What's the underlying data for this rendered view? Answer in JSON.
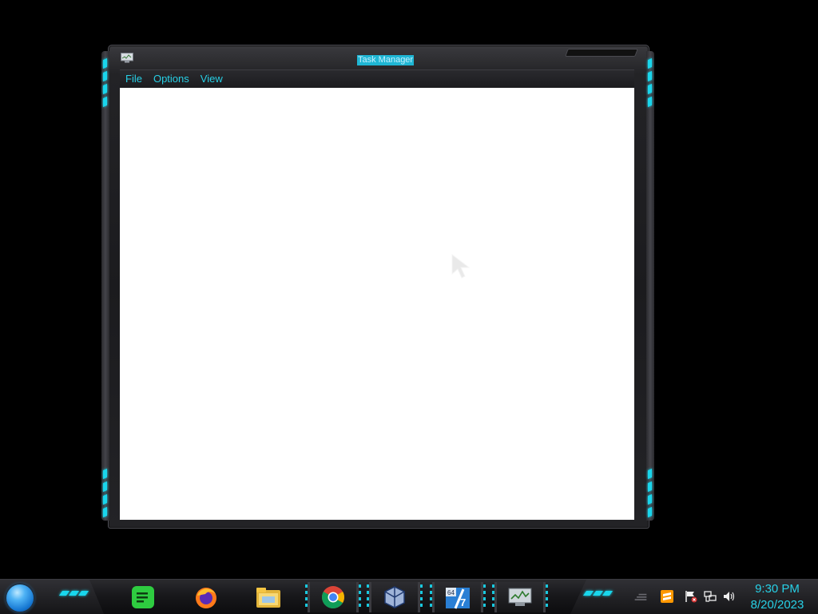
{
  "window": {
    "title": "Task Manager",
    "menu": [
      "File",
      "Options",
      "View"
    ]
  },
  "taskbar": {
    "start_button": "start-orb",
    "pinned": [
      {
        "name": "notes-app-icon",
        "color": "#2ecc40"
      },
      {
        "name": "firefox-icon",
        "color": "#ff7a1a"
      },
      {
        "name": "file-explorer-icon",
        "color": "#f5c542"
      },
      {
        "name": "chrome-icon",
        "color": "#4285f4"
      },
      {
        "name": "virtualbox-icon",
        "color": "#3b6fb5"
      },
      {
        "name": "windows7-64-icon",
        "color": "#2a7fd4"
      },
      {
        "name": "task-manager-icon",
        "color": "#9aa4ad"
      }
    ],
    "tray_icons": [
      "show-hidden-icons",
      "sublime-text-icon",
      "action-center-flag-icon",
      "network-icon",
      "volume-icon"
    ],
    "clock": {
      "time": "9:30 PM",
      "date": "8/20/2023"
    }
  },
  "colors": {
    "accent": "#19d6ec",
    "menu_text": "#27d0e6",
    "client_bg": "#ffffff",
    "desktop_bg": "#000000"
  }
}
